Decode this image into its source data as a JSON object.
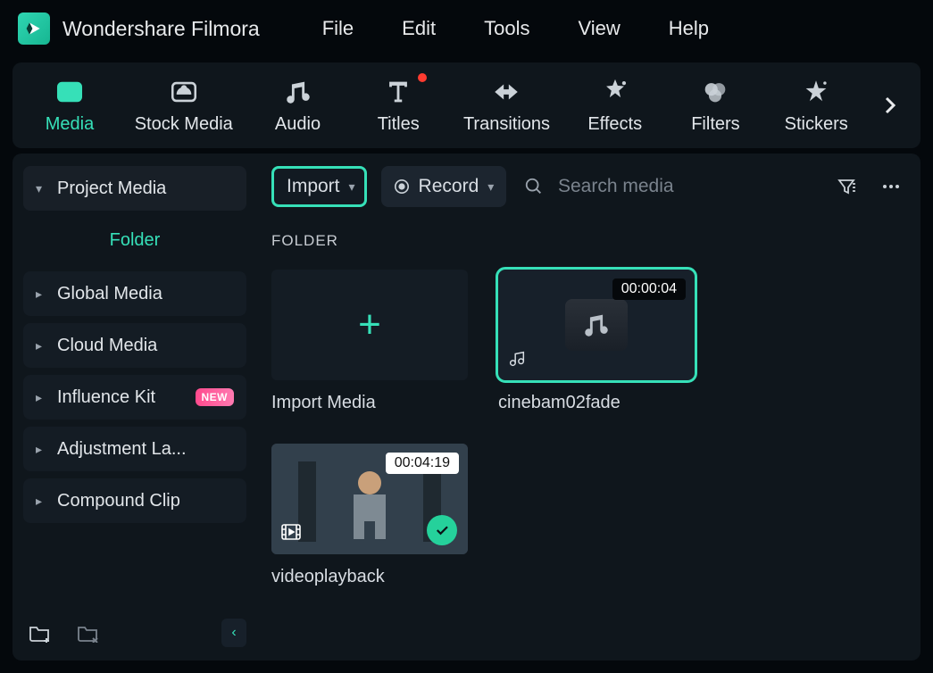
{
  "app": {
    "title": "Wondershare Filmora"
  },
  "menu": {
    "items": [
      "File",
      "Edit",
      "Tools",
      "View",
      "Help"
    ]
  },
  "tabs": [
    {
      "label": "Media",
      "active": true
    },
    {
      "label": "Stock Media"
    },
    {
      "label": "Audio"
    },
    {
      "label": "Titles",
      "dot": true
    },
    {
      "label": "Transitions"
    },
    {
      "label": "Effects"
    },
    {
      "label": "Filters"
    },
    {
      "label": "Stickers"
    }
  ],
  "sidebar": {
    "project": "Project Media",
    "folder": "Folder",
    "items": [
      {
        "label": "Global Media"
      },
      {
        "label": "Cloud Media"
      },
      {
        "label": "Influence Kit",
        "badge": "NEW"
      },
      {
        "label": "Adjustment La..."
      },
      {
        "label": "Compound Clip"
      }
    ]
  },
  "toolbar": {
    "import": "Import",
    "record": "Record",
    "search_placeholder": "Search media"
  },
  "section_title": "FOLDER",
  "cards": {
    "import_tile": "Import Media",
    "audio": {
      "name": "cinebam02fade",
      "duration": "00:00:04"
    },
    "video": {
      "name": "videoplayback",
      "duration": "00:04:19"
    }
  }
}
